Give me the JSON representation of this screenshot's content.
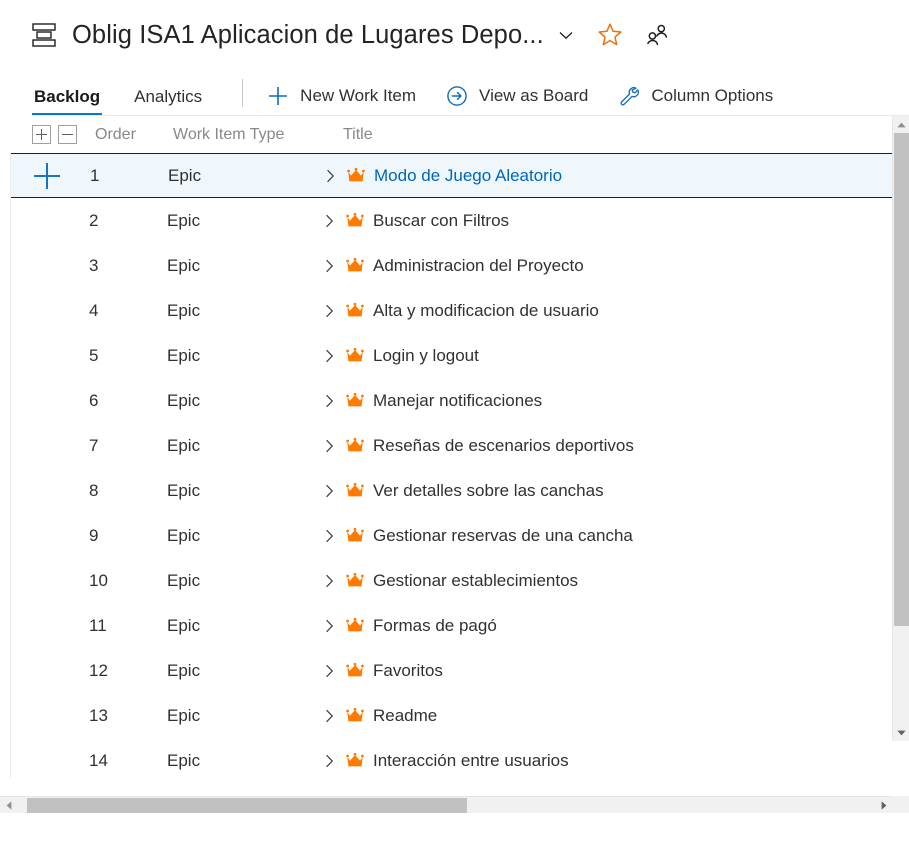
{
  "header": {
    "project_icon": "project-stack-icon",
    "title": "Oblig ISA1 Aplicacion de Lugares Depo...",
    "chevron_icon": "chevron-down-icon",
    "favorite_icon": "star-outline-icon",
    "team_icon": "team-members-icon",
    "favorite_color": "#e8730c"
  },
  "toolbar": {
    "tabs": [
      {
        "label": "Backlog",
        "active": true
      },
      {
        "label": "Analytics",
        "active": false
      }
    ],
    "buttons": [
      {
        "label": "New Work Item",
        "icon": "plus-icon"
      },
      {
        "label": "View as Board",
        "icon": "arrow-circle-right-icon"
      },
      {
        "label": "Column Options",
        "icon": "wrench-icon"
      }
    ],
    "accent_color": "#0078d4"
  },
  "grid": {
    "expand_all_icon": "expand-all-icon",
    "collapse_all_icon": "collapse-all-icon",
    "columns": [
      "Order",
      "Work Item Type",
      "Title"
    ],
    "work_item_icon": "crown-icon",
    "work_item_icon_color": "#ff7b00",
    "expander_icon": "chevron-right-icon",
    "add_child_icon": "plus-icon",
    "selected_row_bg": "#eff6fc",
    "link_color": "#0067b8",
    "rows": [
      {
        "order": "1",
        "type": "Epic",
        "title": "Modo de Juego Aleatorio",
        "selected": true
      },
      {
        "order": "2",
        "type": "Epic",
        "title": "Buscar con Filtros",
        "selected": false
      },
      {
        "order": "3",
        "type": "Epic",
        "title": "Administracion del Proyecto",
        "selected": false
      },
      {
        "order": "4",
        "type": "Epic",
        "title": "Alta y modificacion de usuario",
        "selected": false
      },
      {
        "order": "5",
        "type": "Epic",
        "title": "Login y logout",
        "selected": false
      },
      {
        "order": "6",
        "type": "Epic",
        "title": "Manejar notificaciones",
        "selected": false
      },
      {
        "order": "7",
        "type": "Epic",
        "title": "Reseñas de escenarios deportivos",
        "selected": false
      },
      {
        "order": "8",
        "type": "Epic",
        "title": "Ver detalles sobre las canchas",
        "selected": false
      },
      {
        "order": "9",
        "type": "Epic",
        "title": "Gestionar reservas de una cancha",
        "selected": false
      },
      {
        "order": "10",
        "type": "Epic",
        "title": "Gestionar establecimientos",
        "selected": false
      },
      {
        "order": "11",
        "type": "Epic",
        "title": "Formas de pagó",
        "selected": false
      },
      {
        "order": "12",
        "type": "Epic",
        "title": "Favoritos",
        "selected": false
      },
      {
        "order": "13",
        "type": "Epic",
        "title": "Readme",
        "selected": false
      },
      {
        "order": "14",
        "type": "Epic",
        "title": "Interacción entre usuarios",
        "selected": false
      }
    ]
  },
  "scrollbars": {
    "vertical": {
      "up_icon": "scroll-up-arrow-icon",
      "down_icon": "scroll-down-arrow-icon"
    },
    "horizontal": {
      "left_icon": "scroll-left-arrow-icon",
      "right_icon": "scroll-right-arrow-icon"
    }
  }
}
